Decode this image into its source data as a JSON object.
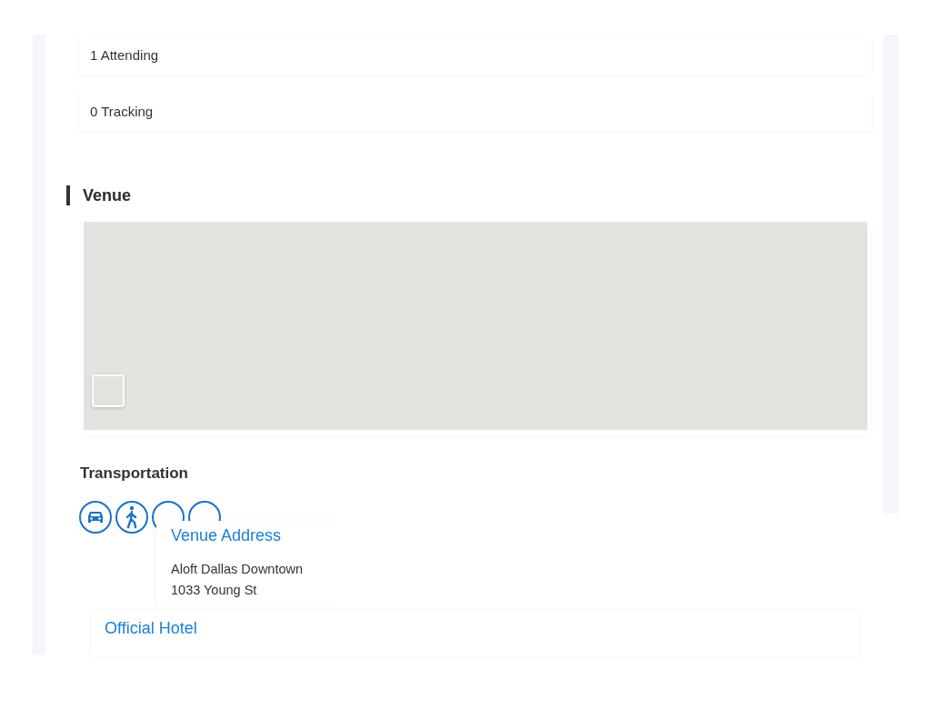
{
  "stats": [
    {
      "text": "1 Attending"
    },
    {
      "text": "0 Tracking"
    }
  ],
  "venue": {
    "heading": "Venue",
    "map": {
      "kind": "map"
    }
  },
  "transportation": {
    "heading": "Transportation",
    "modes": [
      {
        "kind": "car"
      },
      {
        "kind": "walk"
      },
      {
        "kind": "hidden"
      },
      {
        "kind": "hidden"
      }
    ]
  },
  "venue_address": {
    "title": "Venue Address",
    "lines": [
      "Aloft Dallas Downtown",
      "1033 Young St"
    ]
  },
  "official_hotel": {
    "title": "Official Hotel"
  }
}
